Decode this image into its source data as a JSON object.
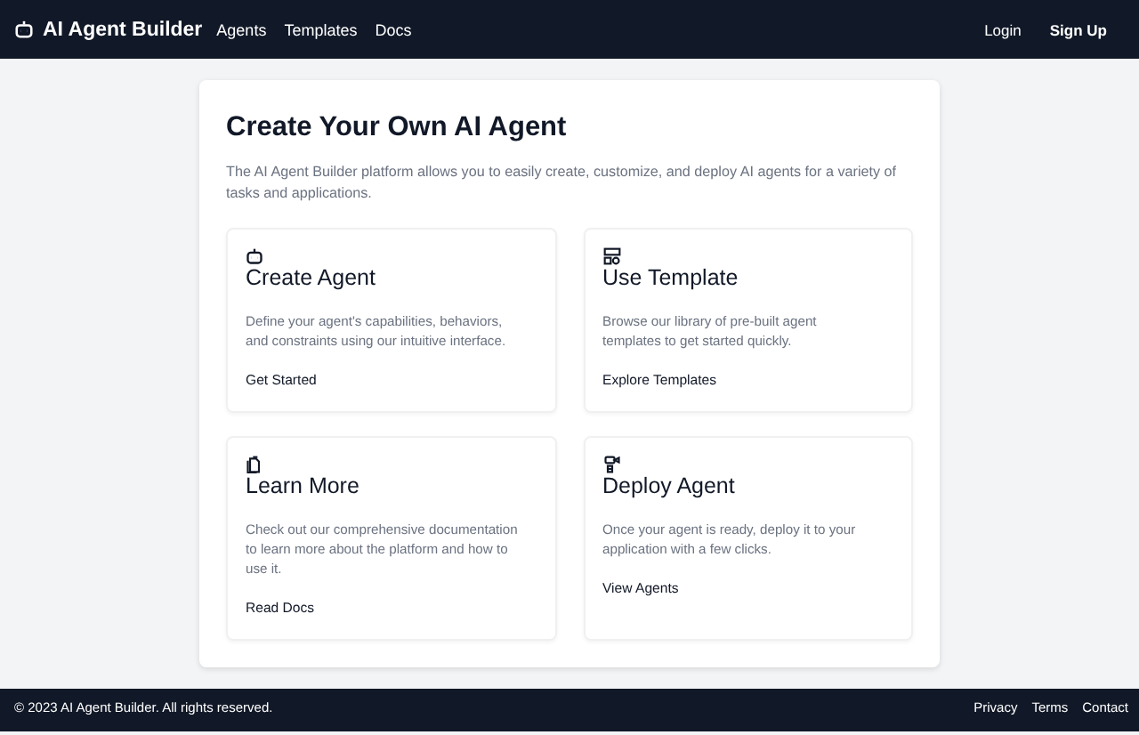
{
  "nav": {
    "brand": "AI Agent Builder",
    "links": [
      "Agents",
      "Templates",
      "Docs"
    ],
    "actions": [
      "Login",
      "Sign Up"
    ]
  },
  "main": {
    "title": "Create Your Own AI Agent",
    "intro": "The AI Agent Builder platform allows you to easily create, customize, and deploy AI agents for a variety of tasks and applications.",
    "cards": [
      {
        "kind": "robot",
        "title": "Create Agent",
        "text": "Define your agent's capabilities, behaviors, and constraints using our intuitive interface.",
        "link": "Get Started"
      },
      {
        "kind": "template",
        "title": "Use Template",
        "text": "Browse our library of pre-built agent templates to get started quickly.",
        "link": "Explore Templates"
      },
      {
        "kind": "docs",
        "title": "Learn More",
        "text": "Check out our comprehensive documentation to learn more about the platform and how to use it.",
        "link": "Read Docs"
      },
      {
        "kind": "deploy",
        "title": "Deploy Agent",
        "text": "Once your agent is ready, deploy it to your application with a few clicks.",
        "link": "View Agents"
      }
    ]
  },
  "footer": {
    "copyright": "© 2023 AI Agent Builder. All rights reserved.",
    "links": [
      "Privacy",
      "Terms",
      "Contact"
    ]
  }
}
